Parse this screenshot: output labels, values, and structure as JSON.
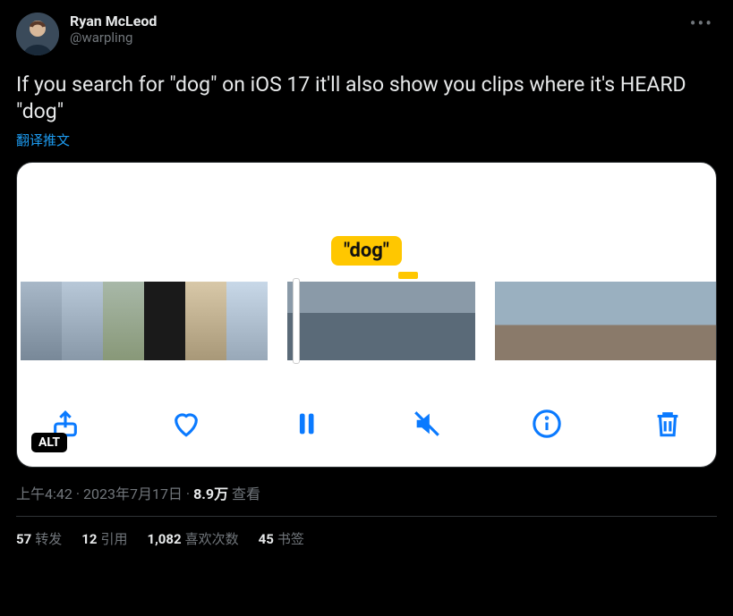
{
  "author": {
    "display_name": "Ryan McLeod",
    "handle": "@warpling"
  },
  "body": "If you search for \"dog\" on iOS 17 it'll also show you clips where it's HEARD \"dog\"",
  "translate_label": "翻译推文",
  "media": {
    "highlight_text": "\"dog\"",
    "alt_label": "ALT",
    "toolbar_icons": [
      "share-icon",
      "heart-icon",
      "pause-icon",
      "mute-icon",
      "info-icon",
      "trash-icon"
    ]
  },
  "meta": {
    "time": "上午4:42",
    "date": "2023年7月17日",
    "views_count": "8.9万",
    "views_suffix": "查看"
  },
  "stats": {
    "retweets_count": "57",
    "retweets_label": "转发",
    "quotes_count": "12",
    "quotes_label": "引用",
    "likes_count": "1,082",
    "likes_label": "喜欢次数",
    "bookmarks_count": "45",
    "bookmarks_label": "书签"
  }
}
